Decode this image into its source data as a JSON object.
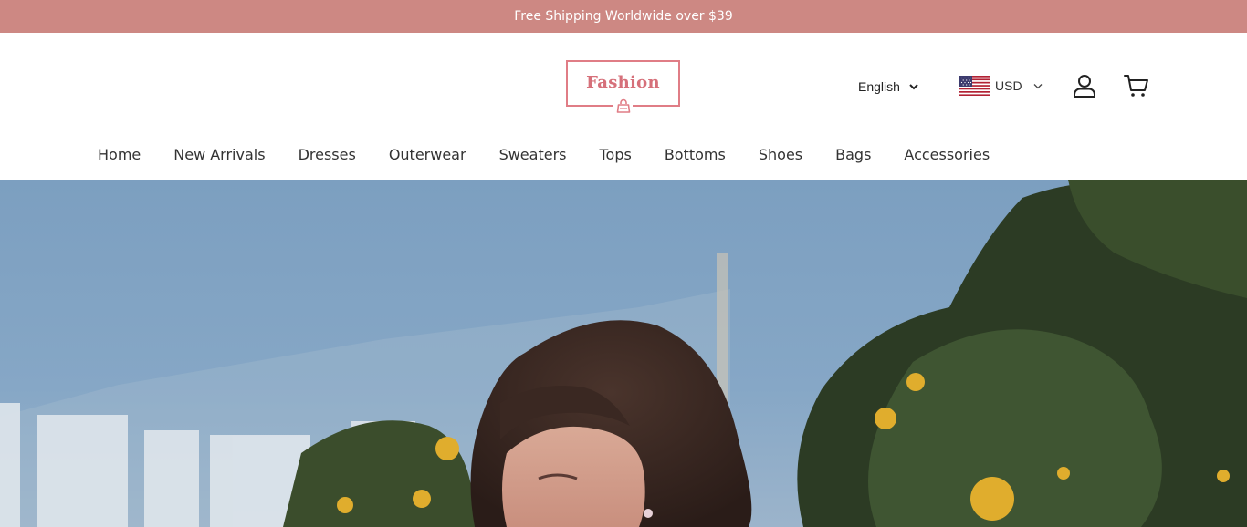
{
  "announcement": {
    "text": "Free Shipping Worldwide over $39"
  },
  "header": {
    "logo": {
      "text": "Fashion",
      "color": "#d6707a"
    },
    "language": {
      "selected": "English"
    },
    "currency": {
      "selected": "USD",
      "flag": "us-flag-icon"
    },
    "icons": {
      "account": "user-icon",
      "cart": "cart-icon"
    }
  },
  "nav": {
    "items": [
      {
        "label": "Home"
      },
      {
        "label": "New Arrivals"
      },
      {
        "label": "Dresses"
      },
      {
        "label": "Outerwear"
      },
      {
        "label": "Sweaters"
      },
      {
        "label": "Tops"
      },
      {
        "label": "Bottoms"
      },
      {
        "label": "Shoes"
      },
      {
        "label": "Bags"
      },
      {
        "label": "Accessories"
      }
    ]
  },
  "theme": {
    "announcement_bg": "#cd8883",
    "accent": "#e07d86"
  }
}
